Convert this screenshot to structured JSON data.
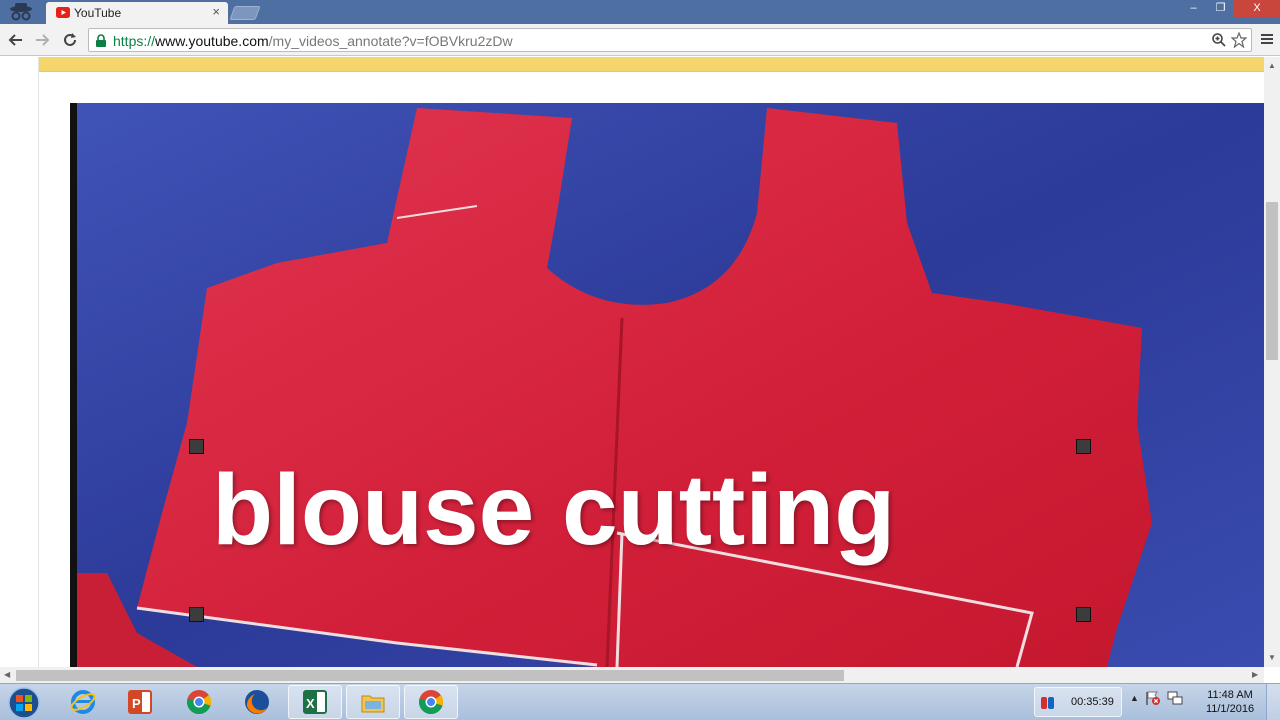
{
  "browser": {
    "tab": {
      "title": "YouTube"
    },
    "address": {
      "scheme": "https://",
      "host": "www.youtube.com",
      "path": "/my_videos_annotate?v=fOBVkru2zDw"
    },
    "window_controls": {
      "minimize": "–",
      "maximize": "❐",
      "close": "X"
    }
  },
  "video": {
    "annotation_text": "blouse cutting"
  },
  "taskbar": {
    "apps": [
      {
        "name": "internet-explorer"
      },
      {
        "name": "powerpoint"
      },
      {
        "name": "chrome"
      },
      {
        "name": "firefox"
      },
      {
        "name": "excel"
      },
      {
        "name": "file-explorer"
      },
      {
        "name": "chrome-active"
      }
    ],
    "tray_timer": "00:35:39",
    "clock_time": "11:48 AM",
    "clock_date": "11/1/2016"
  },
  "colors": {
    "tabstrip": "#4e6fa1",
    "notice_bar": "#f5d66d",
    "fabric_blue": "#2f3f9c",
    "fabric_red": "#d8243d",
    "secure_green": "#0b8043"
  }
}
